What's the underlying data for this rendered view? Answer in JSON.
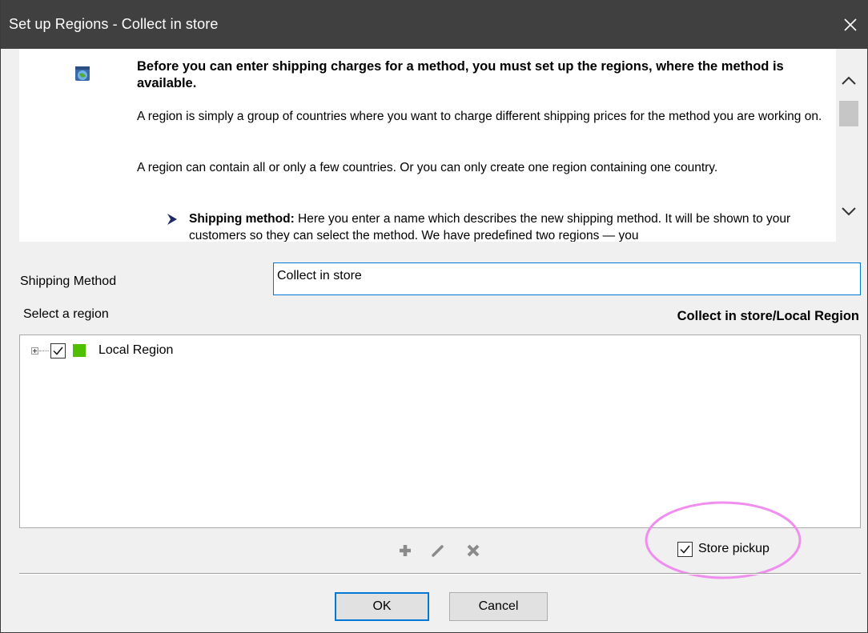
{
  "window": {
    "title": "Set up Regions - Collect in store",
    "close_glyph": "✕"
  },
  "info": {
    "icon": "globe-box-icon",
    "heading": "Before you can enter shipping charges for a method, you must set up the regions, where the method is available.",
    "paragraph1": "A region is simply a group of countries where you want to charge different shipping prices for the method you are working on.",
    "paragraph2": "A region can contain all or only a few countries. Or you can only create one region containing one country.",
    "bullet_term": "Shipping method:",
    "bullet_text": " Here you enter a name which describes the new shipping method. It will be shown to your customers so they can select the method. We have predefined two regions — you"
  },
  "form": {
    "shipping_method_label": "Shipping Method",
    "shipping_method_value": "Collect in store",
    "select_region_label": "Select a region",
    "region_title": "Collect in store/Local Region"
  },
  "regions": [
    {
      "label": "Local Region",
      "checked": true,
      "color": "#4ec000"
    }
  ],
  "toolbar": {
    "add_icon": "plus-icon",
    "edit_icon": "pencil-icon",
    "delete_icon": "x-icon"
  },
  "store_pickup": {
    "label": "Store pickup",
    "checked": true
  },
  "buttons": {
    "ok": "OK",
    "cancel": "Cancel"
  },
  "colors": {
    "titlebar": "#404040",
    "highlight": "#f08ef0",
    "focus_border": "#0078d7"
  }
}
